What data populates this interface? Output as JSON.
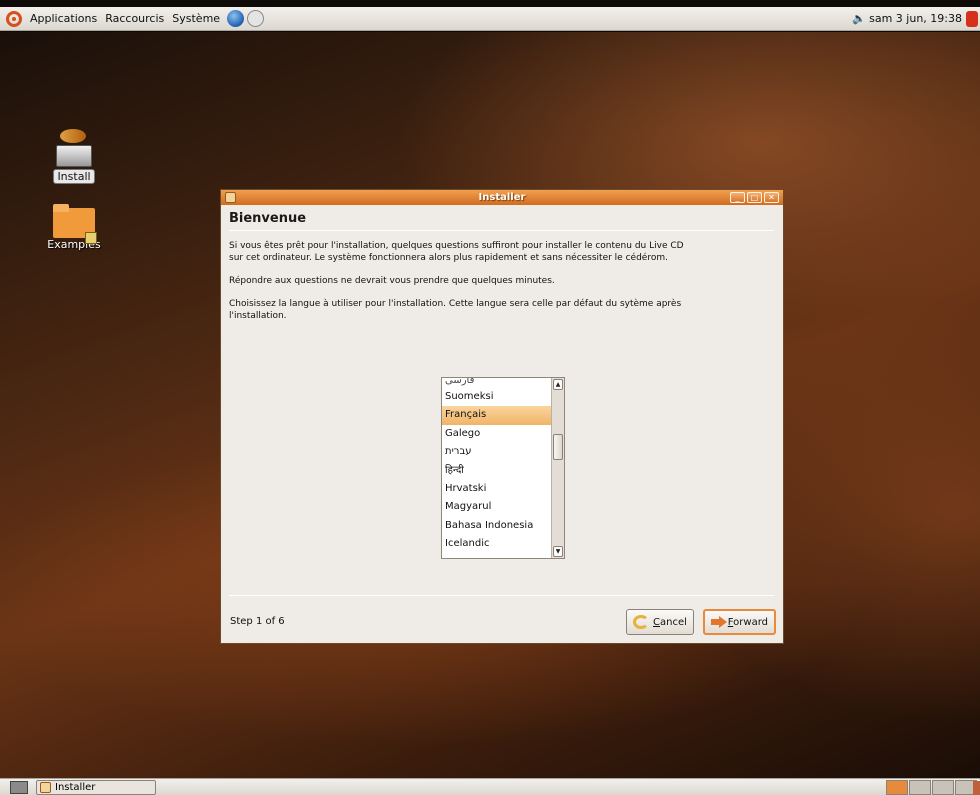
{
  "top_panel": {
    "menus": [
      "Applications",
      "Raccourcis",
      "Système"
    ],
    "clock": "sam  3 jun, 19:38"
  },
  "desktop_icons": {
    "install": "Install",
    "examples": "Examples"
  },
  "window": {
    "title": "Installer",
    "heading": "Bienvenue",
    "paragraphs": [
      "Si vous êtes prêt pour l'installation, quelques questions suffiront pour installer le contenu du Live CD sur cet ordinateur. Le système fonctionnera alors plus rapidement et sans nécessiter le cédérom.",
      "Répondre aux questions ne devrait vous prendre que quelques minutes.",
      "Choisissez la langue à utiliser pour l'installation. Cette langue sera celle par défaut du sytème après l'installation."
    ],
    "languages": [
      "فارسی",
      "Suomeksi",
      "Français",
      "Galego",
      "עברית",
      "हिन्दी",
      "Hrvatski",
      "Magyarul",
      "Bahasa Indonesia",
      "Icelandic"
    ],
    "selected_language": "Français",
    "step": "Step 1 of 6",
    "cancel_label": "Cancel",
    "cancel_mnemonic": "C",
    "cancel_rest": "ancel",
    "forward_label": "Forward",
    "forward_mnemonic": "F",
    "forward_rest": "orward"
  },
  "taskbar": {
    "task_label": "Installer"
  }
}
